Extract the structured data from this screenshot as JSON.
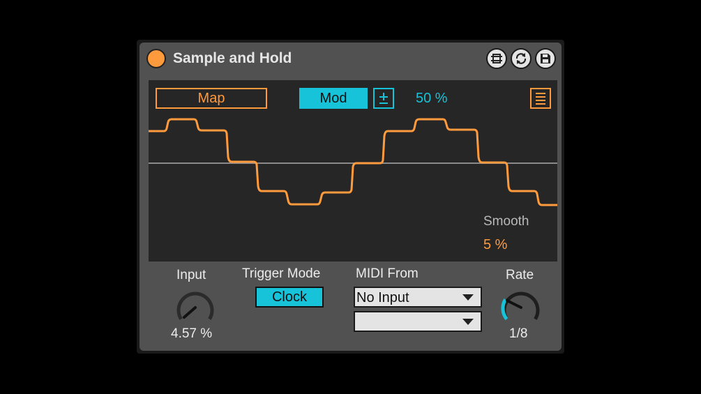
{
  "device": {
    "title": "Sample and Hold",
    "title_icons": [
      "hot-swap-icon",
      "refresh-icon",
      "save-icon"
    ]
  },
  "display": {
    "map_label": "Map",
    "mod_label": "Mod",
    "mod_amount": "50 %",
    "smooth_label": "Smooth",
    "smooth_value": "5 %"
  },
  "controls": {
    "input_label": "Input",
    "input_value": "4.57 %",
    "trigger_mode_label": "Trigger Mode",
    "trigger_mode_value": "Clock",
    "midi_from_label": "MIDI From",
    "midi_from_value": "No Input",
    "midi_channel_value": "",
    "rate_label": "Rate",
    "rate_value": "1/8"
  },
  "colors": {
    "accent_orange": "#ff9a3d",
    "accent_cyan": "#16c3d9",
    "panel": "#515151",
    "display_bg": "#262626"
  }
}
